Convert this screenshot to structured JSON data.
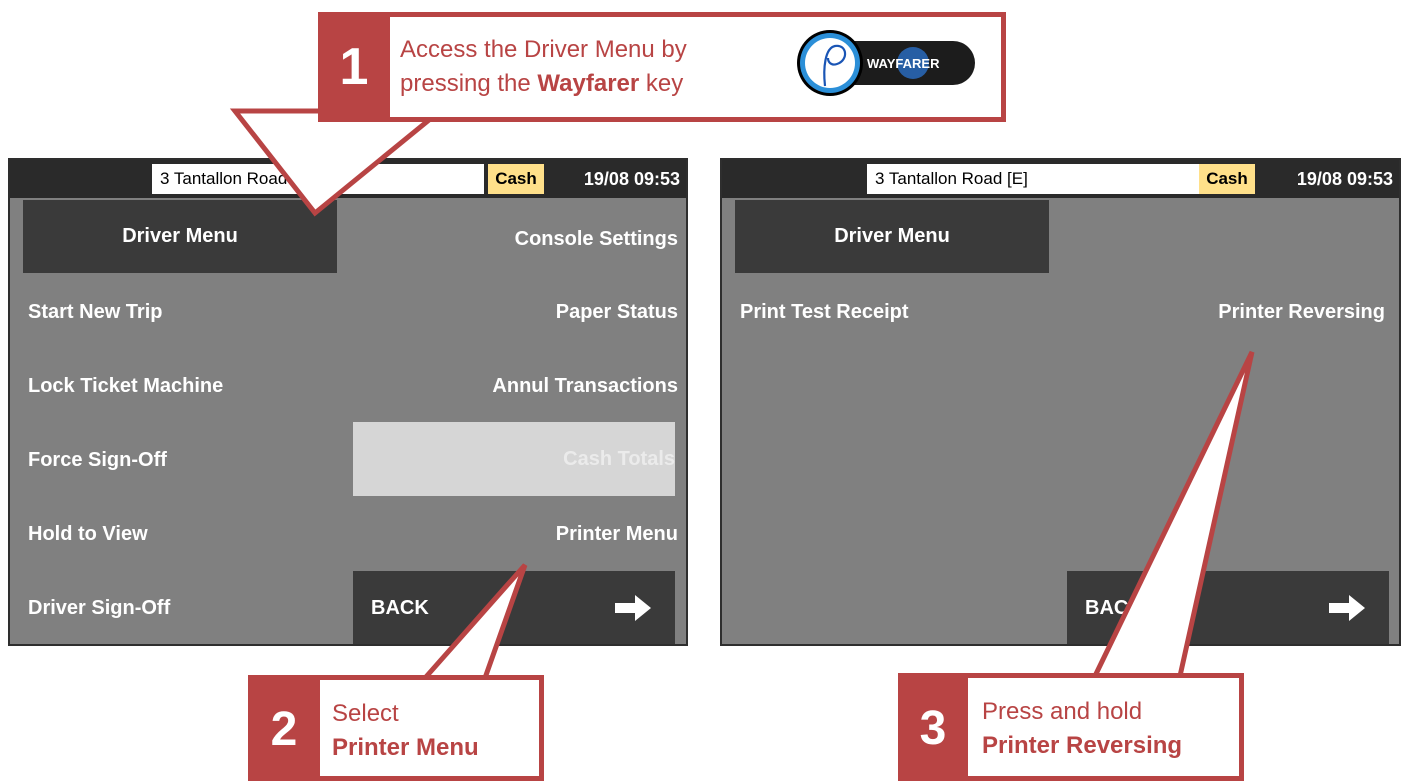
{
  "colors": {
    "accent": "#b84444",
    "screen_bg": "#808080",
    "dark_button": "#3a3a3a",
    "cash_badge": "#ffe08a",
    "disabled": "#d6d6d6"
  },
  "screen1": {
    "route": "3  Tantallon Road [E]",
    "payment": "Cash",
    "datetime": "19/08  09:53",
    "menu_title": "Driver Menu",
    "left_items": [
      "Start New Trip",
      "Lock Ticket Machine",
      "Force Sign-Off",
      "Hold to View",
      "Driver Sign-Off"
    ],
    "right_items": [
      "Console Settings",
      "Paper Status",
      "Annul Transactions",
      "Cash Totals",
      "Printer Menu"
    ],
    "back": "BACK",
    "back_icon": "arrow-right-icon"
  },
  "screen2": {
    "route": "3  Tantallon Road [E]",
    "payment": "Cash",
    "datetime": "19/08  09:53",
    "menu_title": "Driver Menu",
    "left_item": "Print Test Receipt",
    "right_item": "Printer Reversing",
    "back": "BACK",
    "back_icon": "arrow-right-icon"
  },
  "callouts": {
    "step1": {
      "number": "1",
      "line1": "Access the Driver Menu by",
      "line2_prefix": "pressing the ",
      "line2_bold": "Wayfarer",
      "line2_suffix": " key",
      "logo_text": "WAYFARER"
    },
    "step2": {
      "number": "2",
      "line1": "Select",
      "line2_bold": "Printer Menu"
    },
    "step3": {
      "number": "3",
      "line1": "Press and hold",
      "line2_bold": "Printer Reversing"
    }
  }
}
